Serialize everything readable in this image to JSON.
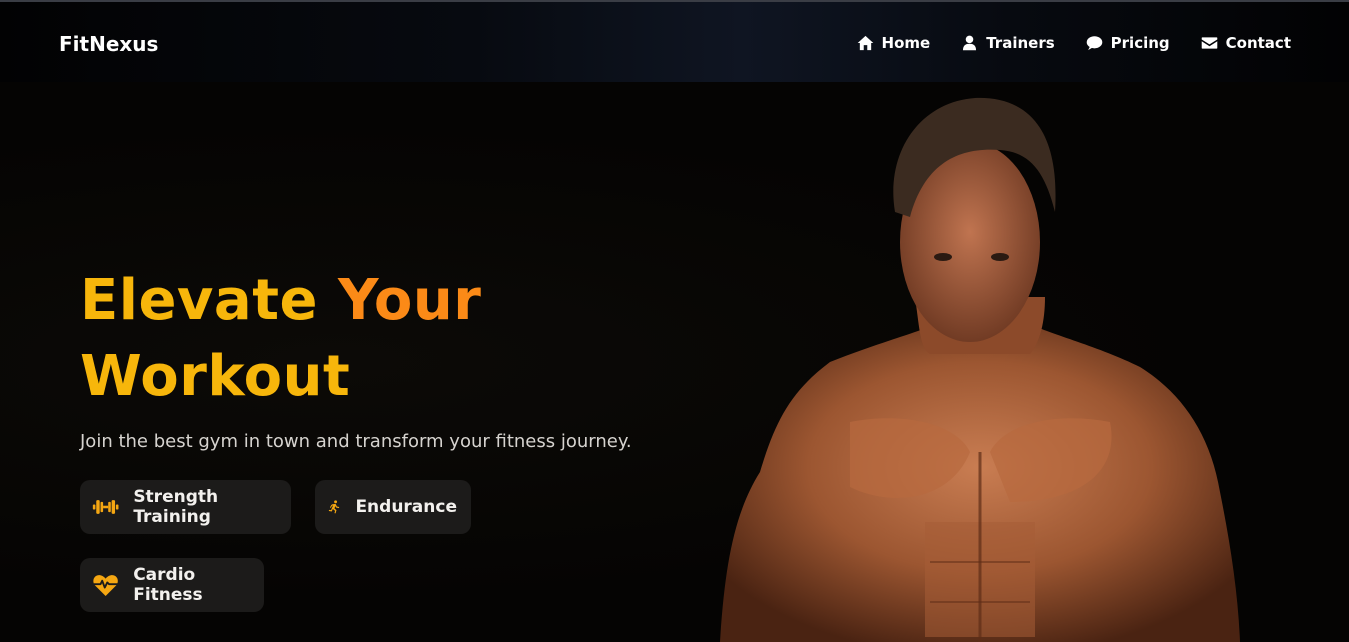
{
  "brand": {
    "logo": "FitNexus"
  },
  "nav": {
    "items": [
      {
        "label": "Home",
        "icon": "home-icon"
      },
      {
        "label": "Trainers",
        "icon": "user-icon"
      },
      {
        "label": "Pricing",
        "icon": "chat-icon"
      },
      {
        "label": "Contact",
        "icon": "envelope-icon"
      }
    ]
  },
  "hero": {
    "title_part1": "Elevate",
    "title_part2": "Your",
    "title_part3": "Workout",
    "subtitle": "Join the best gym in town and transform your fitness journey.",
    "features": [
      {
        "label": "Strength Training",
        "icon": "dumbbell-icon"
      },
      {
        "label": "Endurance",
        "icon": "running-icon"
      },
      {
        "label": "Cardio Fitness",
        "icon": "heartbeat-icon"
      }
    ],
    "image_subject": "muscular-man-photo"
  },
  "colors": {
    "accent_yellow": "#f7b60b",
    "accent_orange": "#fb8a17",
    "chip_bg": "#1c1b1a",
    "background": "#050403"
  }
}
